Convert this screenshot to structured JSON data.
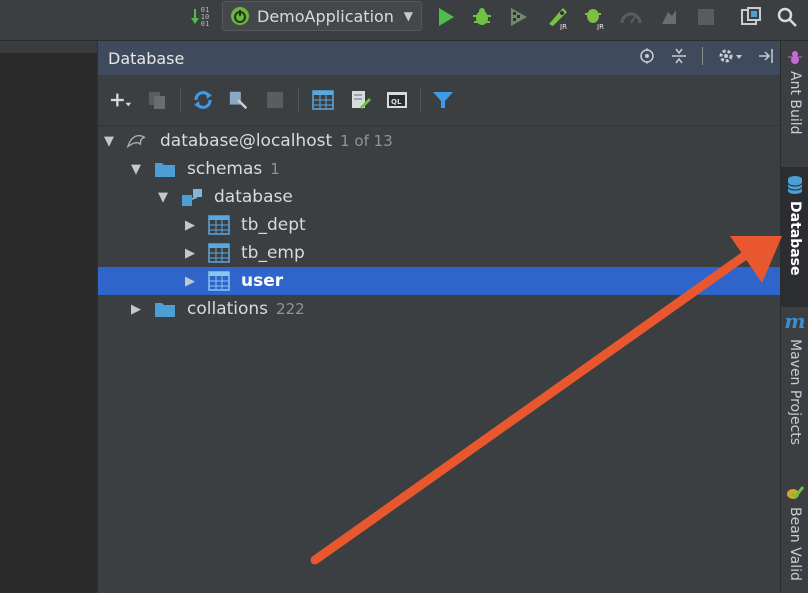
{
  "toolbar": {
    "binary_digits": [
      "01",
      "10",
      "01"
    ],
    "run_config": "DemoApplication"
  },
  "panel": {
    "title": "Database"
  },
  "tree": [
    {
      "label": "database@localhost",
      "count": "1 of 13"
    },
    {
      "label": "schemas",
      "count": "1"
    },
    {
      "label": "database",
      "count": ""
    },
    {
      "label": "tb_dept",
      "count": ""
    },
    {
      "label": "tb_emp",
      "count": ""
    },
    {
      "label": "user",
      "count": ""
    },
    {
      "label": "collations",
      "count": "222"
    }
  ],
  "right_tabs": [
    {
      "label": "Ant Build"
    },
    {
      "label": "Database"
    },
    {
      "label": "Maven Projects"
    },
    {
      "label": "Bean Valid"
    }
  ],
  "colors": {
    "selection": "#2f65ca",
    "panel_header": "#3f4b5c",
    "annotation_arrow": "#e8572e",
    "run_green": "#4fbd4a",
    "bug_green": "#71c244",
    "folder_blue": "#4b9fd5",
    "filter_blue": "#3d9be9",
    "maven_blue": "#3a8fd1"
  }
}
